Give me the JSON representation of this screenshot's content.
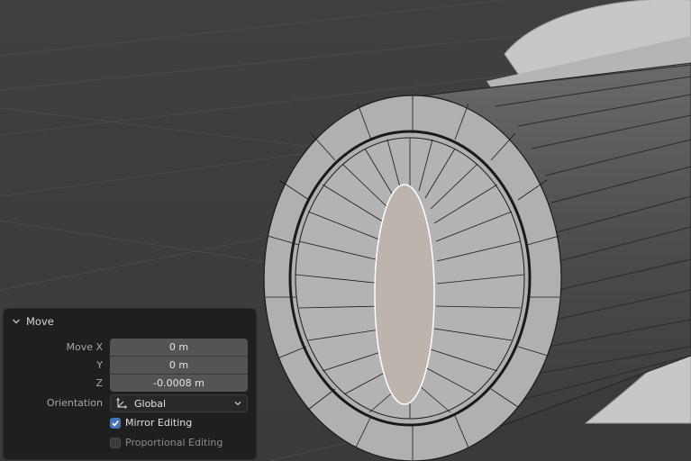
{
  "panel": {
    "title": "Move",
    "move_x_label": "Move X",
    "y_label": "Y",
    "z_label": "Z",
    "move_x_value": "0 m",
    "y_value": "0 m",
    "z_value": "-0.0008 m",
    "orientation_label": "Orientation",
    "orientation_value": "Global",
    "mirror_editing_label": "Mirror Editing",
    "mirror_editing_checked": true,
    "proportional_editing_label": "Proportional Editing",
    "proportional_editing_checked": false
  },
  "colors": {
    "viewport_bg": "#3d3d3d",
    "panel_bg": "#1f1f1f",
    "field_bg": "#545454",
    "checkbox_on": "#4772b3",
    "mesh_face": "#b0b0b0",
    "mesh_edge": "#1a1a1a",
    "selected_face": "#bdb4ae",
    "selected_edge": "#ffffff"
  }
}
